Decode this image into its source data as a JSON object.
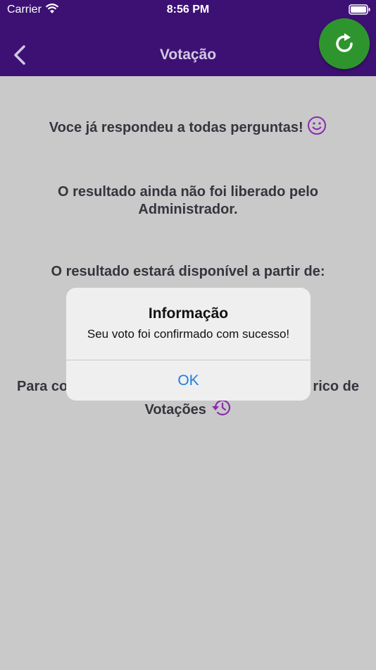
{
  "status_bar": {
    "carrier": "Carrier",
    "time": "8:56 PM"
  },
  "header": {
    "title": "Votação",
    "back_icon": "chevron-left-icon",
    "refresh_icon": "refresh-icon"
  },
  "content": {
    "answered_all": "Voce já respondeu a todas perguntas!",
    "not_released": "O resultado ainda não foi liberado pelo Administrador.",
    "available_from": "O resultado estará disponível a partir de:",
    "history_start": "Para co",
    "history_end": "rico de",
    "history_line2": "Votações"
  },
  "alert": {
    "title": "Informação",
    "message": "Seu voto foi confirmado com sucesso!",
    "ok_label": "OK"
  },
  "colors": {
    "header_bg": "#3d1173",
    "accent_purple": "#8b2bb0",
    "refresh_green": "#2e952e",
    "alert_button": "#1f7de0"
  }
}
